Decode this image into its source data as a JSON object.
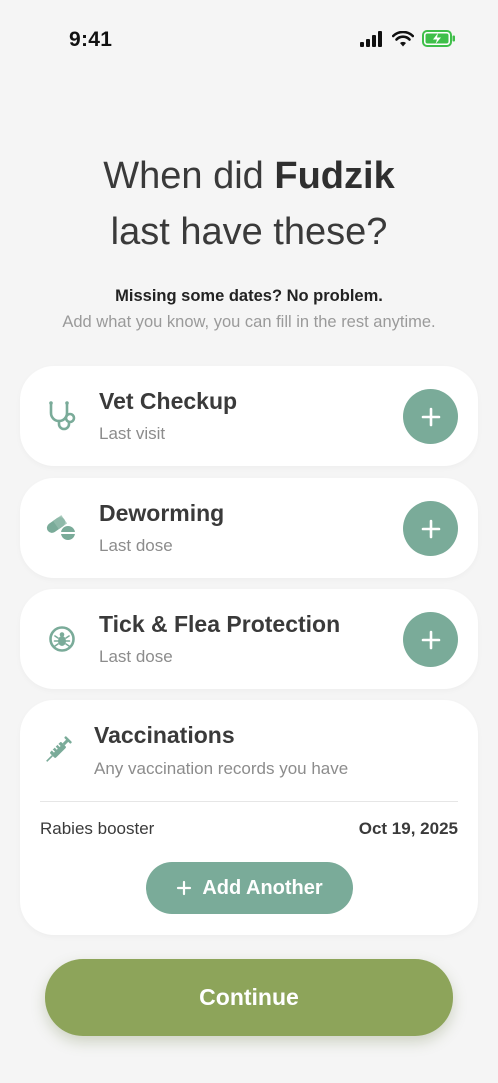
{
  "status_bar": {
    "time": "9:41"
  },
  "header": {
    "title_prefix": "When did ",
    "pet_name": "Fudzik",
    "title_suffix": "last have these?",
    "subtitle_strong": "Missing some dates? No problem.",
    "subtitle_light": "Add what you know, you can fill in the rest anytime."
  },
  "cards": [
    {
      "title": "Vet Checkup",
      "subtitle": "Last visit",
      "icon": "stethoscope-icon"
    },
    {
      "title": "Deworming",
      "subtitle": "Last dose",
      "icon": "pills-icon"
    },
    {
      "title": "Tick & Flea Protection",
      "subtitle": "Last dose",
      "icon": "tick-icon"
    }
  ],
  "vaccinations": {
    "title": "Vaccinations",
    "subtitle": "Any vaccination records you have",
    "icon": "syringe-icon",
    "records": [
      {
        "name": "Rabies booster",
        "date": "Oct 19, 2025"
      }
    ],
    "add_label": "Add Another"
  },
  "continue_label": "Continue",
  "colors": {
    "accent": "#7aab99",
    "continue": "#8da45a",
    "background": "#f5f5f5"
  }
}
